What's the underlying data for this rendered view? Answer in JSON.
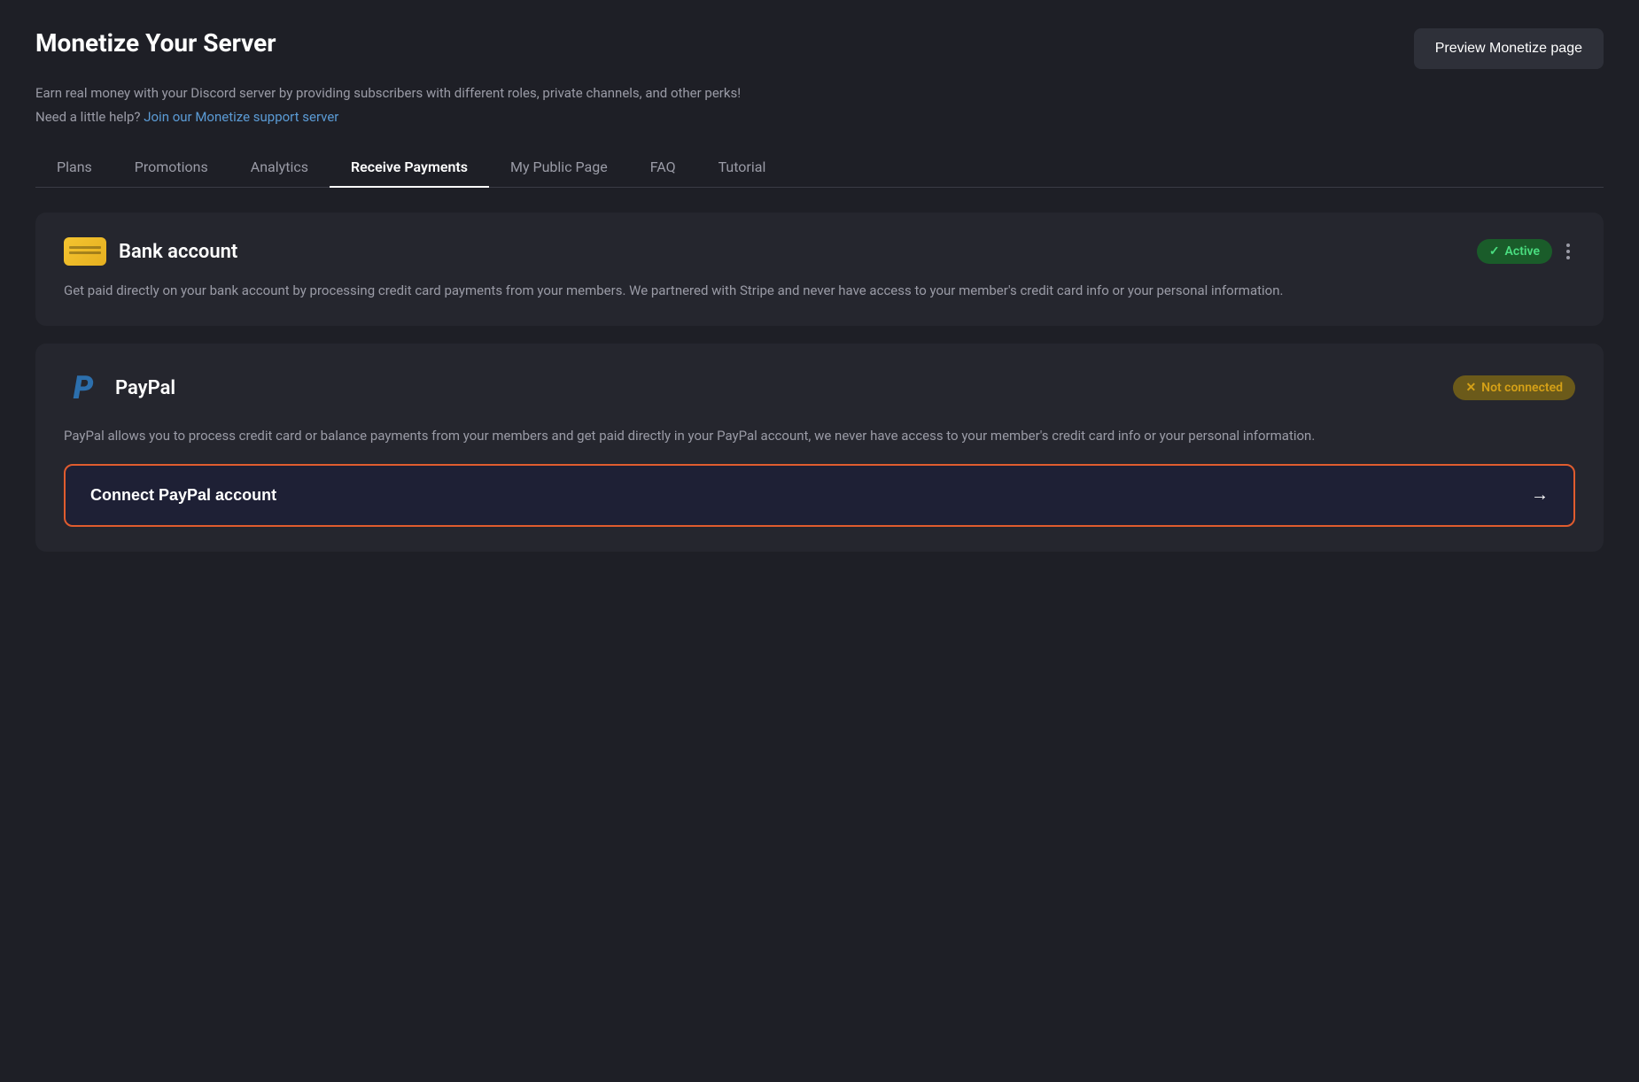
{
  "header": {
    "title": "Monetize Your Server",
    "subtitle": "Earn real money with your Discord server by providing subscribers with different roles, private channels, and other perks!",
    "support_text": "Need a little help?",
    "support_link_text": "Join our Monetize support server",
    "preview_btn_label": "Preview Monetize page"
  },
  "tabs": [
    {
      "id": "plans",
      "label": "Plans",
      "active": false
    },
    {
      "id": "promotions",
      "label": "Promotions",
      "active": false
    },
    {
      "id": "analytics",
      "label": "Analytics",
      "active": false
    },
    {
      "id": "receive_payments",
      "label": "Receive Payments",
      "active": true
    },
    {
      "id": "my_public_page",
      "label": "My Public Page",
      "active": false
    },
    {
      "id": "faq",
      "label": "FAQ",
      "active": false
    },
    {
      "id": "tutorial",
      "label": "Tutorial",
      "active": false
    }
  ],
  "bank_card": {
    "title": "Bank account",
    "status_label": "Active",
    "status_check": "✓",
    "description": "Get paid directly on your bank account by processing credit card payments from your members. We partnered with Stripe and never have access to your member's credit card info or your personal information."
  },
  "paypal_card": {
    "title": "PayPal",
    "status_label": "Not connected",
    "status_x": "✕",
    "description": "PayPal allows you to process credit card or balance payments from your members and get paid directly in your PayPal account, we never have access to your member's credit card info or your personal information.",
    "connect_btn_label": "Connect PayPal account",
    "connect_btn_arrow": "→"
  }
}
